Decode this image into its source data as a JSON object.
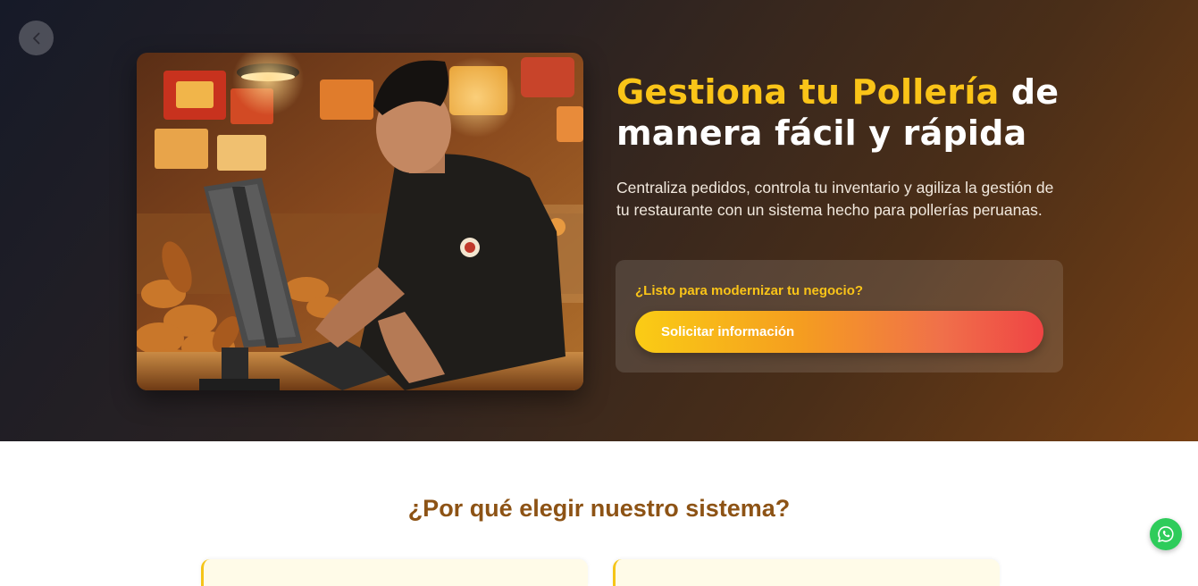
{
  "hero": {
    "title_accent": "Gestiona tu Pollería",
    "title_rest_line1": " de",
    "title_line2": "manera fácil y rápida",
    "description": "Centraliza pedidos, controla tu inventario y agiliza la gestión de tu restaurante con un sistema hecho para pollerías peruanas.",
    "cta_question": "¿Listo para modernizar tu negocio?",
    "cta_button_label": "Solicitar información",
    "image_alt": "Empleado de pollería usando la caja registradora",
    "colors": {
      "accent_yellow": "#fac418",
      "button_start": "#facc15",
      "button_end": "#ef4444"
    }
  },
  "features": {
    "title": "¿Por qué elegir nuestro sistema?",
    "section_title_color": "#8d5315"
  },
  "icons": {
    "back": "chevron-left-icon",
    "whatsapp": "whatsapp-icon"
  }
}
